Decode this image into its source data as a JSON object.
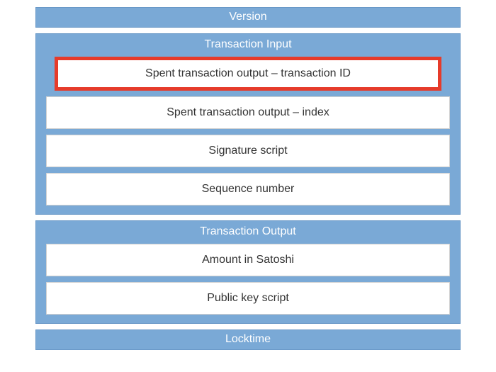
{
  "version": {
    "label": "Version"
  },
  "input": {
    "title": "Transaction Input",
    "fields": [
      {
        "label": "Spent transaction output – transaction ID",
        "highlighted": true
      },
      {
        "label": "Spent transaction output – index"
      },
      {
        "label": "Signature script"
      },
      {
        "label": "Sequence number"
      }
    ]
  },
  "output": {
    "title": "Transaction Output",
    "fields": [
      {
        "label": "Amount in Satoshi"
      },
      {
        "label": "Public key script"
      }
    ]
  },
  "locktime": {
    "label": "Locktime"
  }
}
